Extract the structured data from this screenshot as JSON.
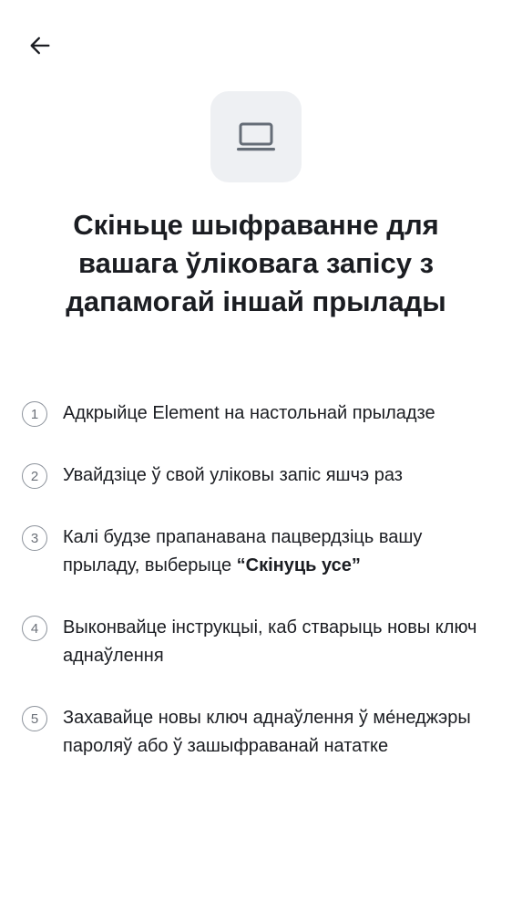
{
  "header": {
    "back_icon": "arrow-left-icon"
  },
  "hero": {
    "icon": "laptop-icon",
    "bg_color": "#eef0f3",
    "icon_color": "#656d77"
  },
  "title": "Скіньце шыфраванне для вашага ўліковага запісу з дапамогай іншай прылады",
  "steps": [
    {
      "number": "1",
      "text": "Адкрыйце Element на настольнай прыладзе"
    },
    {
      "number": "2",
      "text": "Увайдзіце ў свой уліковы запіс яшчэ раз"
    },
    {
      "number": "3",
      "text": "Калі будзе прапанавана пацвердзіць вашу прыладу, выберыце ",
      "bold": "“Скінуць усе”"
    },
    {
      "number": "4",
      "text": "Выконвайце інструкцыі, каб стварыць новы ключ аднаўлення"
    },
    {
      "number": "5",
      "text": "Захавайце новы ключ аднаўлення ў ме́неджэры пароляў або ў зашыфраванай нататке"
    }
  ]
}
